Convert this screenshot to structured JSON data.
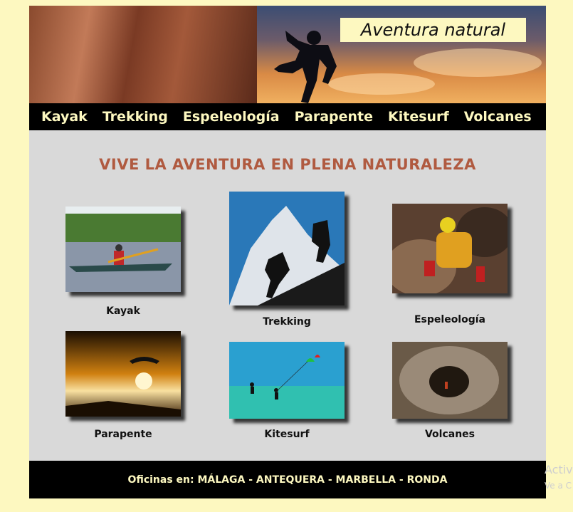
{
  "banner": {
    "brand": "Aventura natural"
  },
  "nav": [
    "Kayak",
    "Trekking",
    "Espeleología",
    "Parapente",
    "Kitesurf",
    "Volcanes"
  ],
  "main": {
    "headline": "VIVE LA AVENTURA EN PLENA NATURALEZA",
    "tiles": [
      "Kayak",
      "Trekking",
      "Espeleología",
      "Parapente",
      "Kitesurf",
      "Volcanes"
    ]
  },
  "footer": {
    "text": "Oficinas en: MÁLAGA - ANTEQUERA - MARBELLA - RONDA"
  },
  "watermark": {
    "line1": "Activ",
    "line2": "Ve a C"
  },
  "colors": {
    "background": "#fdf8c0",
    "nav": "#000000",
    "headline": "#b05a40",
    "panel": "#d9d9d9"
  }
}
